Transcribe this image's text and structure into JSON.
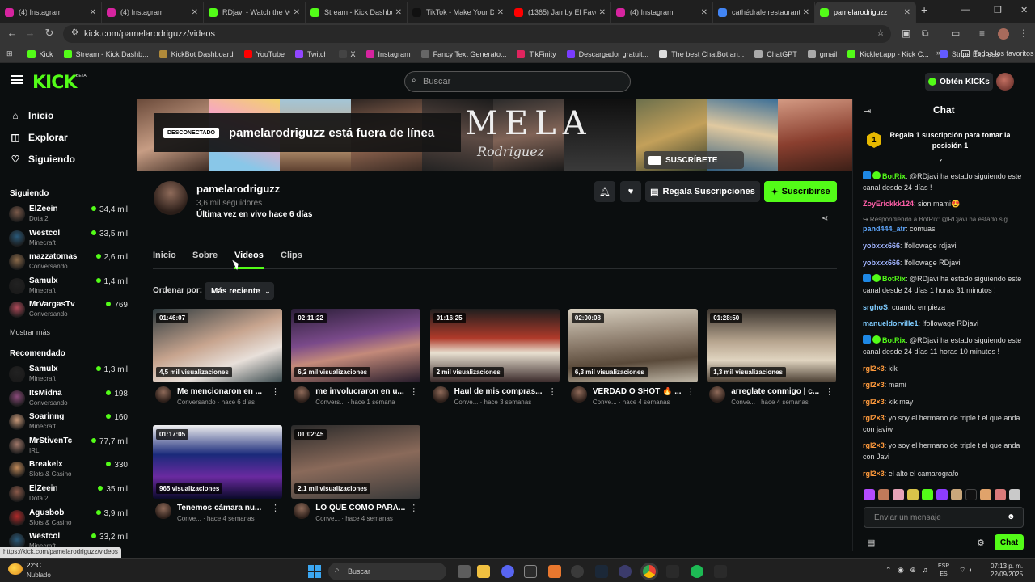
{
  "browser": {
    "tabs": [
      {
        "title": "(4) Instagram",
        "color": "#d6249f"
      },
      {
        "title": "(4) Instagram",
        "color": "#d6249f"
      },
      {
        "title": "RDjavi - Watch the VOD",
        "color": "#53fc18"
      },
      {
        "title": "Stream - Kick Dashboard",
        "color": "#53fc18"
      },
      {
        "title": "TikTok - Make Your Day",
        "color": "#111111"
      },
      {
        "title": "(1365) Jamby El Favo",
        "color": "#ff0000"
      },
      {
        "title": "(4) Instagram",
        "color": "#d6249f"
      },
      {
        "title": "cathédrale restaurant",
        "color": "#4285f4"
      },
      {
        "title": "pamelarodriguzz",
        "color": "#53fc18"
      }
    ],
    "url": "kick.com/pamelarodriguzz/videos",
    "bookmarks": [
      {
        "label": "Kick",
        "color": "#53fc18"
      },
      {
        "label": "Stream - Kick Dashb...",
        "color": "#53fc18"
      },
      {
        "label": "KickBot Dashboard",
        "color": "#b08a3a"
      },
      {
        "label": "YouTube",
        "color": "#ff0000"
      },
      {
        "label": "Twitch",
        "color": "#9146ff"
      },
      {
        "label": "X",
        "color": "#444444"
      },
      {
        "label": "Instagram",
        "color": "#d6249f"
      },
      {
        "label": "Fancy Text Generato...",
        "color": "#666666"
      },
      {
        "label": "TikFinity",
        "color": "#e0245e"
      },
      {
        "label": "Descargador gratuit...",
        "color": "#7a3cff"
      },
      {
        "label": "The best ChatBot an...",
        "color": "#dddddd"
      },
      {
        "label": "ChatGPT",
        "color": "#aaaaaa"
      },
      {
        "label": "gmail",
        "color": "#aaaaaa"
      },
      {
        "label": "Kicklet.app - Kick C...",
        "color": "#53fc18"
      },
      {
        "label": "Stripe Express",
        "color": "#635bff"
      }
    ],
    "all_bookmarks": "Todos los favoritos",
    "status_url": "https://kick.com/pamelarodriguzz/videos"
  },
  "header": {
    "logo": "KICK",
    "beta": "BETA",
    "search_placeholder": "Buscar",
    "get_kicks": "Obtén KICKs"
  },
  "sidebar": {
    "nav": [
      {
        "label": "Inicio",
        "icon": "home-icon"
      },
      {
        "label": "Explorar",
        "icon": "compass-icon"
      },
      {
        "label": "Siguiendo",
        "icon": "heart-icon"
      }
    ],
    "following_title": "Siguiendo",
    "following": [
      {
        "name": "ElZeein",
        "category": "Dota 2",
        "viewers": "34,4 mil"
      },
      {
        "name": "Westcol",
        "category": "Minecraft",
        "viewers": "33,5 mil"
      },
      {
        "name": "mazzatomas",
        "category": "Conversando",
        "viewers": "2,6 mil"
      },
      {
        "name": "Samulx",
        "category": "Minecraft",
        "viewers": "1,4 mil"
      },
      {
        "name": "MrVargasTv",
        "category": "Conversando",
        "viewers": "769"
      }
    ],
    "show_more": "Mostrar más",
    "recommended_title": "Recomendado",
    "recommended": [
      {
        "name": "Samulx",
        "category": "Minecraft",
        "viewers": "1,3 mil"
      },
      {
        "name": "ItsMidna",
        "category": "Conversando",
        "viewers": "198"
      },
      {
        "name": "Soarinng",
        "category": "Minecraft",
        "viewers": "160"
      },
      {
        "name": "MrStivenTc",
        "category": "IRL",
        "viewers": "77,7 mil"
      },
      {
        "name": "Breakelx",
        "category": "Slots & Casino",
        "viewers": "330"
      },
      {
        "name": "ElZeein",
        "category": "Dota 2",
        "viewers": "35 mil"
      },
      {
        "name": "Agusbob",
        "category": "Slots & Casino",
        "viewers": "3,9 mil"
      },
      {
        "name": "Westcol",
        "category": "Minecraft",
        "viewers": "33,2 mil"
      }
    ]
  },
  "channel": {
    "banner_title": "MELA",
    "banner_subtitle": "Rodriguez",
    "banner_subscribe": "SUSCRÍBETE",
    "offline_badge": "DESCONECTADO",
    "offline_message": "pamelarodriguzz está fuera de línea",
    "name": "pamelarodriguzz",
    "followers": "3,6 mil seguidores",
    "last_live": "Última vez en vivo hace 6 días",
    "gift_label": "Regala Suscripciones",
    "subscribe_label": "Suscribirse",
    "tabs": [
      "Inicio",
      "Sobre",
      "Videos",
      "Clips"
    ],
    "active_tab": "Videos",
    "sort_label": "Ordenar por:",
    "sort_value": "Más reciente"
  },
  "videos": [
    {
      "duration": "01:46:07",
      "views": "4,5 mil visualizaciones",
      "title": "Me mencionaron en ...",
      "meta": "Conversando · hace 6 días"
    },
    {
      "duration": "02:11:22",
      "views": "6,2 mil visualizaciones",
      "title": "me involucraron en u...",
      "meta": "Convers... · hace 1 semana"
    },
    {
      "duration": "01:16:25",
      "views": "2 mil visualizaciones",
      "title": "Haul de mis compras...",
      "meta": "Conve... · hace 3 semanas"
    },
    {
      "duration": "02:00:08",
      "views": "6,3 mil visualizaciones",
      "title": "VERDAD O SHOT 🔥 ...",
      "meta": "Conve... · hace 4 semanas"
    },
    {
      "duration": "01:28:50",
      "views": "1,3 mil visualizaciones",
      "title": "arreglate conmigo | c...",
      "meta": "Conve... · hace 4 semanas"
    },
    {
      "duration": "01:17:05",
      "views": "965 visualizaciones",
      "title": "Tenemos cámara nu...",
      "meta": "Conve... · hace 4 semanas"
    },
    {
      "duration": "01:02:45",
      "views": "2,1 mil visualizaciones",
      "title": "LO QUE COMO PARA...",
      "meta": "Conve... · hace 4 semanas"
    }
  ],
  "chat": {
    "title": "Chat",
    "pinned_rank": "1",
    "pinned_text": "Regala 1 suscripción para tomar la posición 1",
    "messages": [
      {
        "user": "BotRix",
        "color": "#53fc18",
        "badge": true,
        "text": ": @RDjavi ha estado siguiendo este canal desde 24 días !"
      },
      {
        "user": "ZoyErickkk124",
        "color": "#ff5fa8",
        "badge": false,
        "text": ": sion mami😍"
      },
      {
        "user": "",
        "color": "#888888",
        "badge": false,
        "reply": true,
        "text": "↪ Respondiendo a BotRix: @RDjavi ha estado sig..."
      },
      {
        "user": "pand444_atr",
        "color": "#5fa8ff",
        "badge": false,
        "text": ": comuasi"
      },
      {
        "user": "yobxxx666",
        "color": "#a0b4ff",
        "badge": false,
        "text": ": !followage rdjavi"
      },
      {
        "user": "yobxxx666",
        "color": "#a0b4ff",
        "badge": false,
        "text": ": !followage RDjavi"
      },
      {
        "user": "BotRix",
        "color": "#53fc18",
        "badge": true,
        "text": ": @RDjavi ha estado siguiendo este canal desde 24 días 1 horas 31 minutos !"
      },
      {
        "user": "srghoS",
        "color": "#7ecbff",
        "badge": false,
        "text": ": cuando empieza"
      },
      {
        "user": "manueldorville1",
        "color": "#7ecbff",
        "badge": false,
        "text": ": !followage RDjavi"
      },
      {
        "user": "BotRix",
        "color": "#53fc18",
        "badge": true,
        "text": ": @RDjavi ha estado siguiendo este canal desde 24 días 11 horas 10 minutos !"
      },
      {
        "user": "rgl2×3",
        "color": "#ff9a3c",
        "badge": false,
        "text": ": kik"
      },
      {
        "user": "rgl2×3",
        "color": "#ff9a3c",
        "badge": false,
        "text": ": mami"
      },
      {
        "user": "rgl2×3",
        "color": "#ff9a3c",
        "badge": false,
        "text": ": kik may"
      },
      {
        "user": "rgl2×3",
        "color": "#ff9a3c",
        "badge": false,
        "text": ": yo soy el hermano de triple t el que anda con javiw"
      },
      {
        "user": "rgl2×3",
        "color": "#ff9a3c",
        "badge": false,
        "text": ": yo soy el hermano de triple t el que anda con Javi"
      },
      {
        "user": "rgl2×3",
        "color": "#ff9a3c",
        "badge": false,
        "text": ": el alto el camarografo"
      }
    ],
    "input_placeholder": "Enviar un mensaje",
    "send_label": "Chat"
  },
  "taskbar": {
    "temperature": "22°C",
    "weather": "Nublado",
    "search": "Buscar",
    "lang_top": "ESP",
    "lang_bottom": "ES",
    "time": "07:13 p. m.",
    "date": "22/09/2025"
  },
  "colors": {
    "accent": "#53fc18",
    "background": "#0b0e0f"
  }
}
